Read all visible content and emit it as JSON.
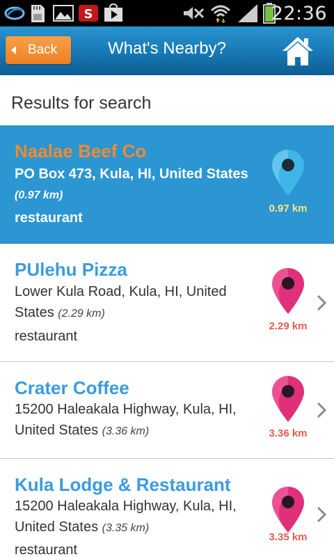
{
  "status_bar": {
    "time": "22:36"
  },
  "header": {
    "back_label": "Back",
    "title": "What's Nearby?"
  },
  "results_header": "Results for search",
  "results": [
    {
      "name": "Naalae Beef Co",
      "address": "PO Box 473, Kula, HI, United States",
      "distance_inline": "(0.97 km)",
      "distance": "0.97 km",
      "category": "restaurant",
      "selected": true
    },
    {
      "name": "PUlehu Pizza",
      "address": "Lower Kula Road, Kula, HI, United States",
      "distance_inline": "(2.29 km)",
      "distance": "2.29 km",
      "category": "restaurant",
      "selected": false
    },
    {
      "name": "Crater Coffee",
      "address": "15200 Haleakala Highway, Kula, HI, United States",
      "distance_inline": "(3.36 km)",
      "distance": "3.36 km",
      "category": "",
      "selected": false
    },
    {
      "name": "Kula Lodge & Restaurant",
      "address": "15200 Haleakala Highway, Kula, HI, United States",
      "distance_inline": "(3.35 km)",
      "distance": "3.35 km",
      "category": "restaurant",
      "selected": false
    }
  ],
  "colors": {
    "header": "#1678b4",
    "back_button": "#ee7f22",
    "selected_row": "#2b96d1",
    "name_link": "#3a9be0",
    "pin_selected": "#3fb5e8",
    "pin_default": "#e0307a",
    "distance_text": "#e55d4b"
  },
  "icons": [
    "signal-app-icon",
    "sd-card-icon",
    "gallery-icon",
    "app-s-icon",
    "play-store-icon",
    "mute-icon",
    "wifi-icon",
    "cell-signal-icon",
    "battery-icon",
    "home-icon",
    "map-pin-icon",
    "chevron-right-icon"
  ]
}
